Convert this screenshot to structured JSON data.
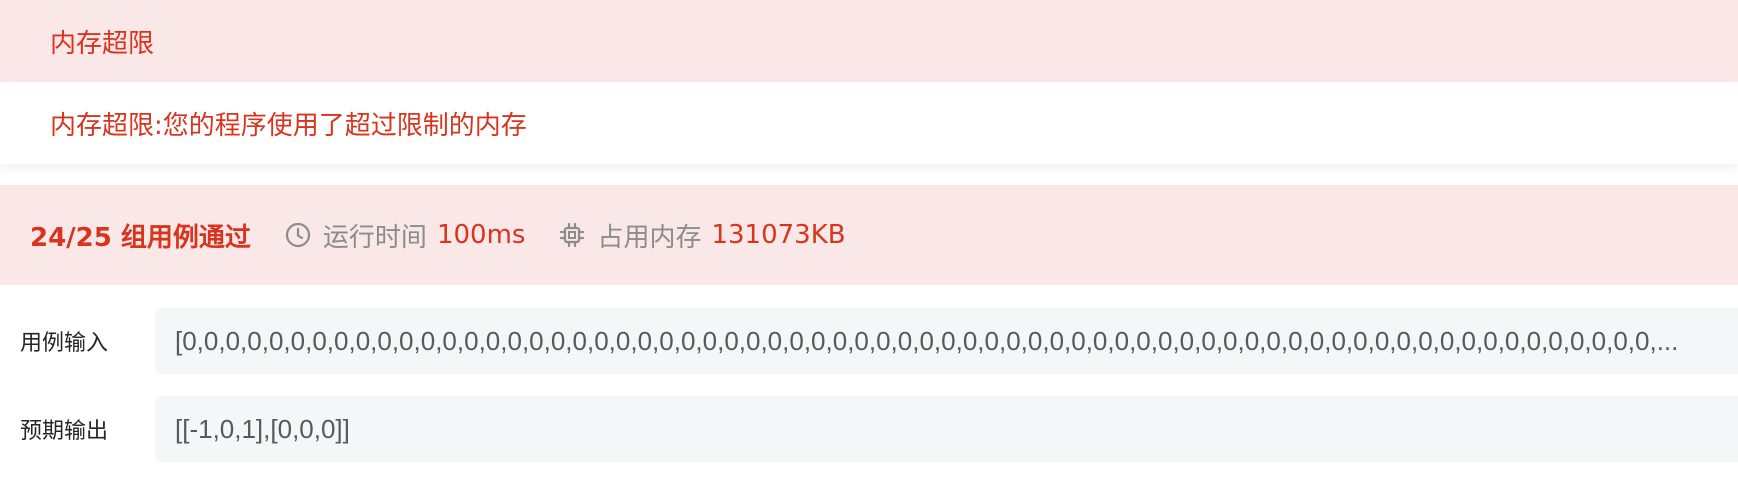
{
  "alert": {
    "title": "内存超限",
    "message": "内存超限:您的程序使用了超过限制的内存"
  },
  "summary": {
    "passed": "24/25 组用例通过",
    "time_label": "运行时间",
    "time_value": "100ms",
    "memory_label": "占用内存",
    "memory_value": "131073KB",
    "icons": [
      "clock-icon",
      "chip-icon"
    ],
    "accent_color": "#d8341e",
    "background_color": "#fae7e8"
  },
  "testcase": {
    "input_label": "用例输入",
    "input_value": "[0,0,0,0,0,0,0,0,0,0,0,0,0,0,0,0,0,0,0,0,0,0,0,0,0,0,0,0,0,0,0,0,0,0,0,0,0,0,0,0,0,0,0,0,0,0,0,0,0,0,0,0,0,0,0,0,0,0,0,0,0,0,0,0,0,0,0,0,...",
    "output_label": "预期输出",
    "output_value": "[[-1,0,1],[0,0,0]]"
  }
}
